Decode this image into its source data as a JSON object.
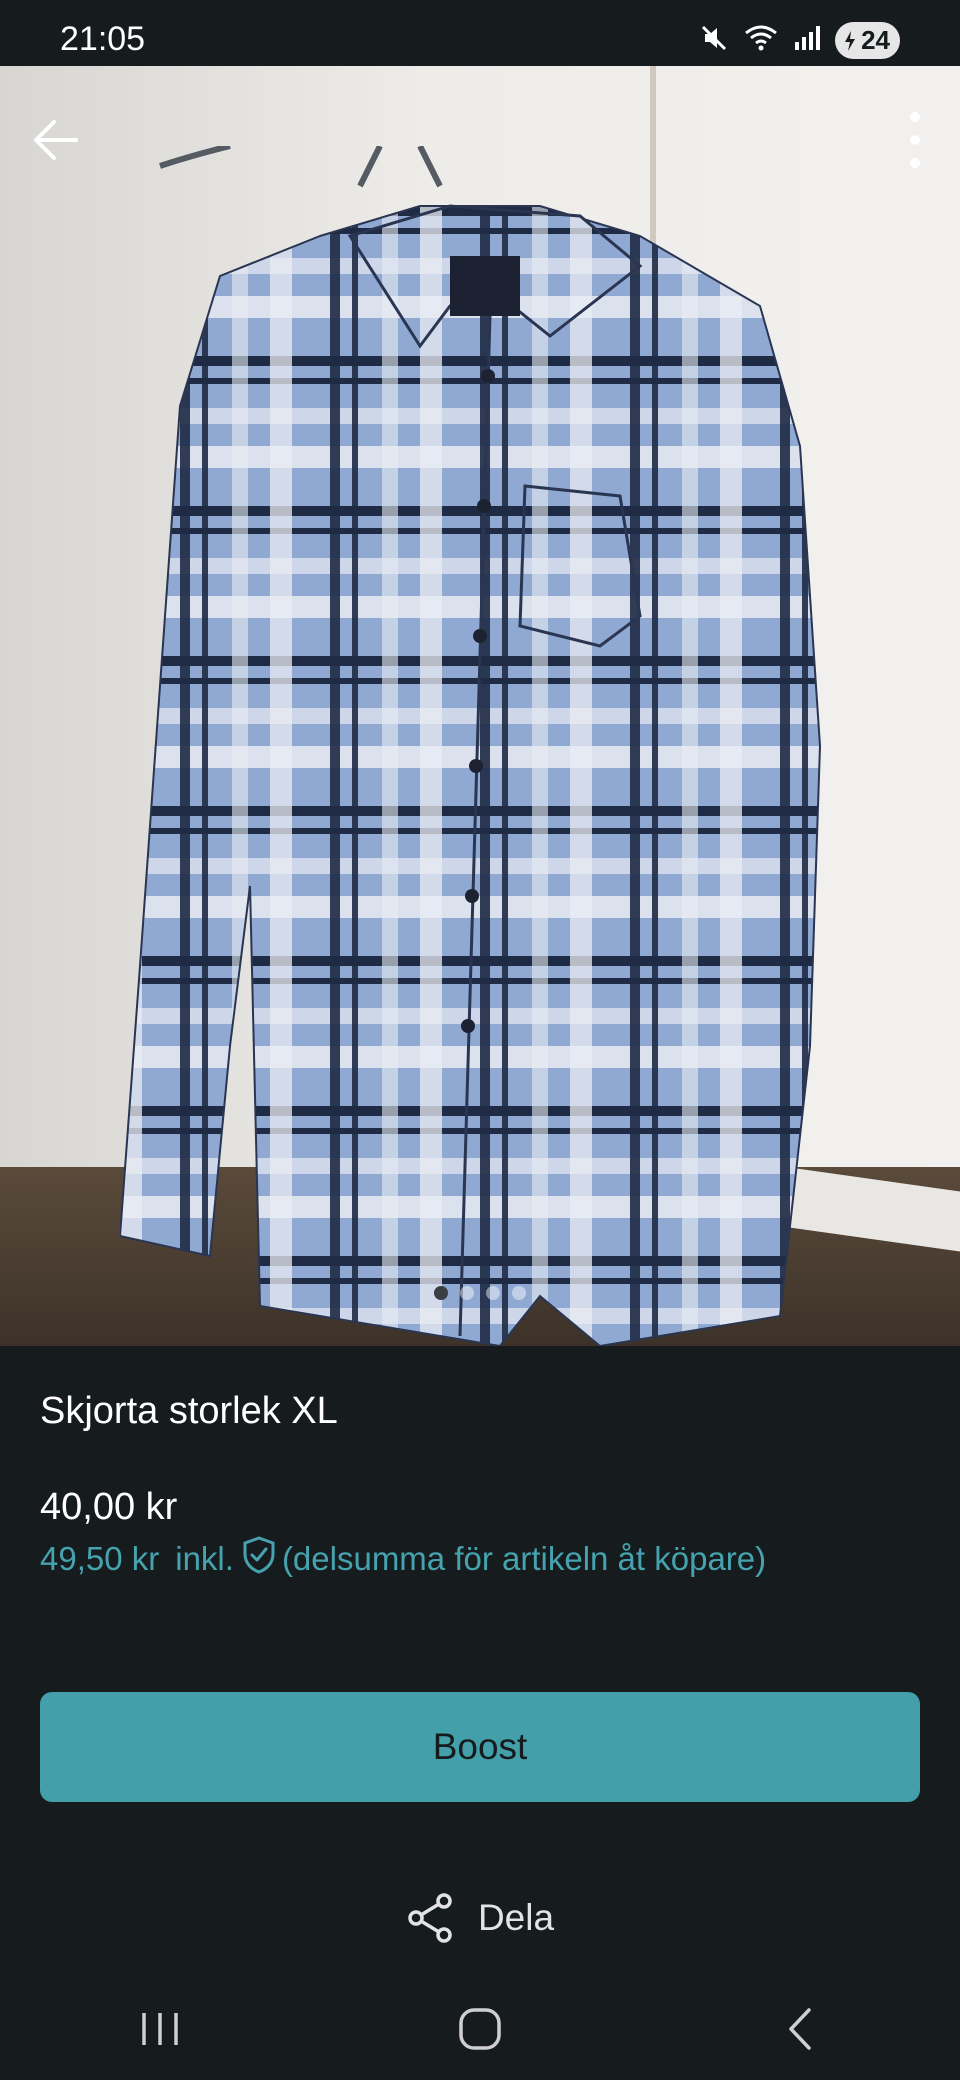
{
  "status_bar": {
    "time": "21:05",
    "battery": "24",
    "icons": [
      "mute-icon",
      "wifi-icon",
      "signal-icon",
      "battery-icon"
    ]
  },
  "toolbar": {
    "back_icon": "arrow-left-icon",
    "more_icon": "more-vertical-icon"
  },
  "gallery": {
    "image_count": 4,
    "active_index": 0
  },
  "listing": {
    "title": "Skjorta storlek XL",
    "price": "40,00 kr",
    "price_incl_amount": "49,50 kr",
    "price_incl_label": "inkl.",
    "price_incl_note": "(delsumma för artikeln åt köpare)"
  },
  "actions": {
    "boost_label": "Boost",
    "share_label": "Dela"
  },
  "colors": {
    "background": "#161c1e",
    "accent": "#43a0ab",
    "accent_text": "#45a2ae"
  }
}
